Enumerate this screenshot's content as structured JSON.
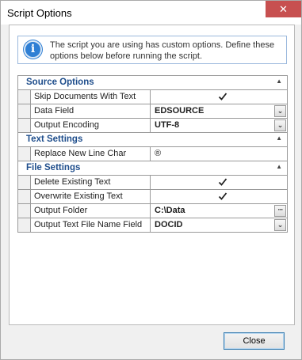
{
  "window": {
    "title": "Script Options",
    "close_glyph": "✕"
  },
  "info": {
    "icon": "info-icon",
    "icon_glyph": "i",
    "text": "The script you are using has custom options. Define these options below before running the script."
  },
  "groups": [
    {
      "title": "Source Options",
      "rows": [
        {
          "label": "Skip Documents With Text",
          "kind": "checkbox",
          "checked": true
        },
        {
          "label": "Data Field",
          "kind": "dropdown",
          "value": "EDSOURCE"
        },
        {
          "label": "Output Encoding",
          "kind": "dropdown",
          "value": "UTF-8"
        }
      ]
    },
    {
      "title": "Text Settings",
      "rows": [
        {
          "label": "Replace New Line Char",
          "kind": "text",
          "value": "®"
        }
      ]
    },
    {
      "title": "File Settings",
      "rows": [
        {
          "label": "Delete Existing Text",
          "kind": "checkbox",
          "checked": true
        },
        {
          "label": "Overwrite Existing Text",
          "kind": "checkbox",
          "checked": true
        },
        {
          "label": "Output Folder",
          "kind": "browse",
          "value": "C:\\Data"
        },
        {
          "label": "Output Text File Name Field",
          "kind": "dropdown",
          "value": "DOCID"
        }
      ]
    }
  ],
  "buttons": {
    "close_label": "Close"
  },
  "glyphs": {
    "collapse": "▲",
    "dropdown": "⌄",
    "browse": "···"
  },
  "colors": {
    "group_title": "#1f4e8c",
    "info_icon": "#2f7fd4",
    "close_x_bg": "#c75050"
  }
}
